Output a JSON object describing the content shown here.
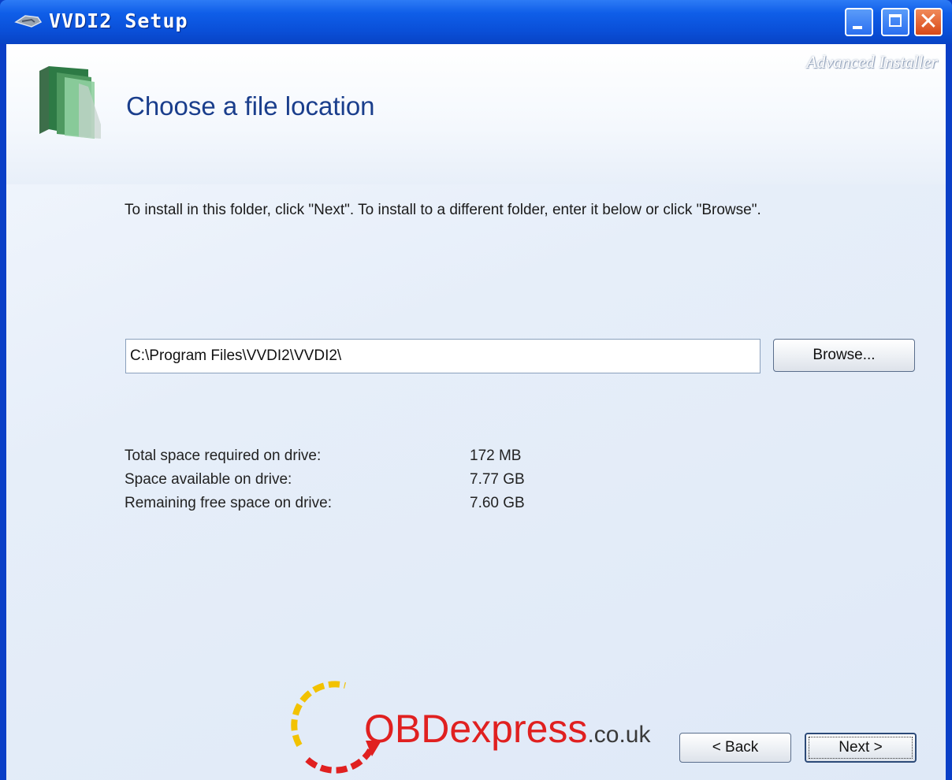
{
  "window": {
    "title": "VVDI2 Setup"
  },
  "header": {
    "brand": "Advanced Installer",
    "heading": "Choose a file location"
  },
  "main": {
    "instruction": "To install in this folder, click \"Next\". To install to a different folder, enter it below or click \"Browse\".",
    "path_value": "C:\\Program Files\\VVDI2\\VVDI2\\",
    "browse_label": "Browse...",
    "space": [
      {
        "label": "Total space required on drive:",
        "value": "172 MB"
      },
      {
        "label": "Space available on drive:",
        "value": "7.77 GB"
      },
      {
        "label": "Remaining free space on drive:",
        "value": "7.60 GB"
      }
    ]
  },
  "footer": {
    "back_label": "< Back",
    "next_label": "Next >"
  },
  "watermark": {
    "main": "OBDexpress",
    "suffix": ".co.uk"
  },
  "colors": {
    "titlebar": "#0a4fd8",
    "heading": "#1a3e8c",
    "close": "#d84818",
    "watermark": "#e02020"
  }
}
